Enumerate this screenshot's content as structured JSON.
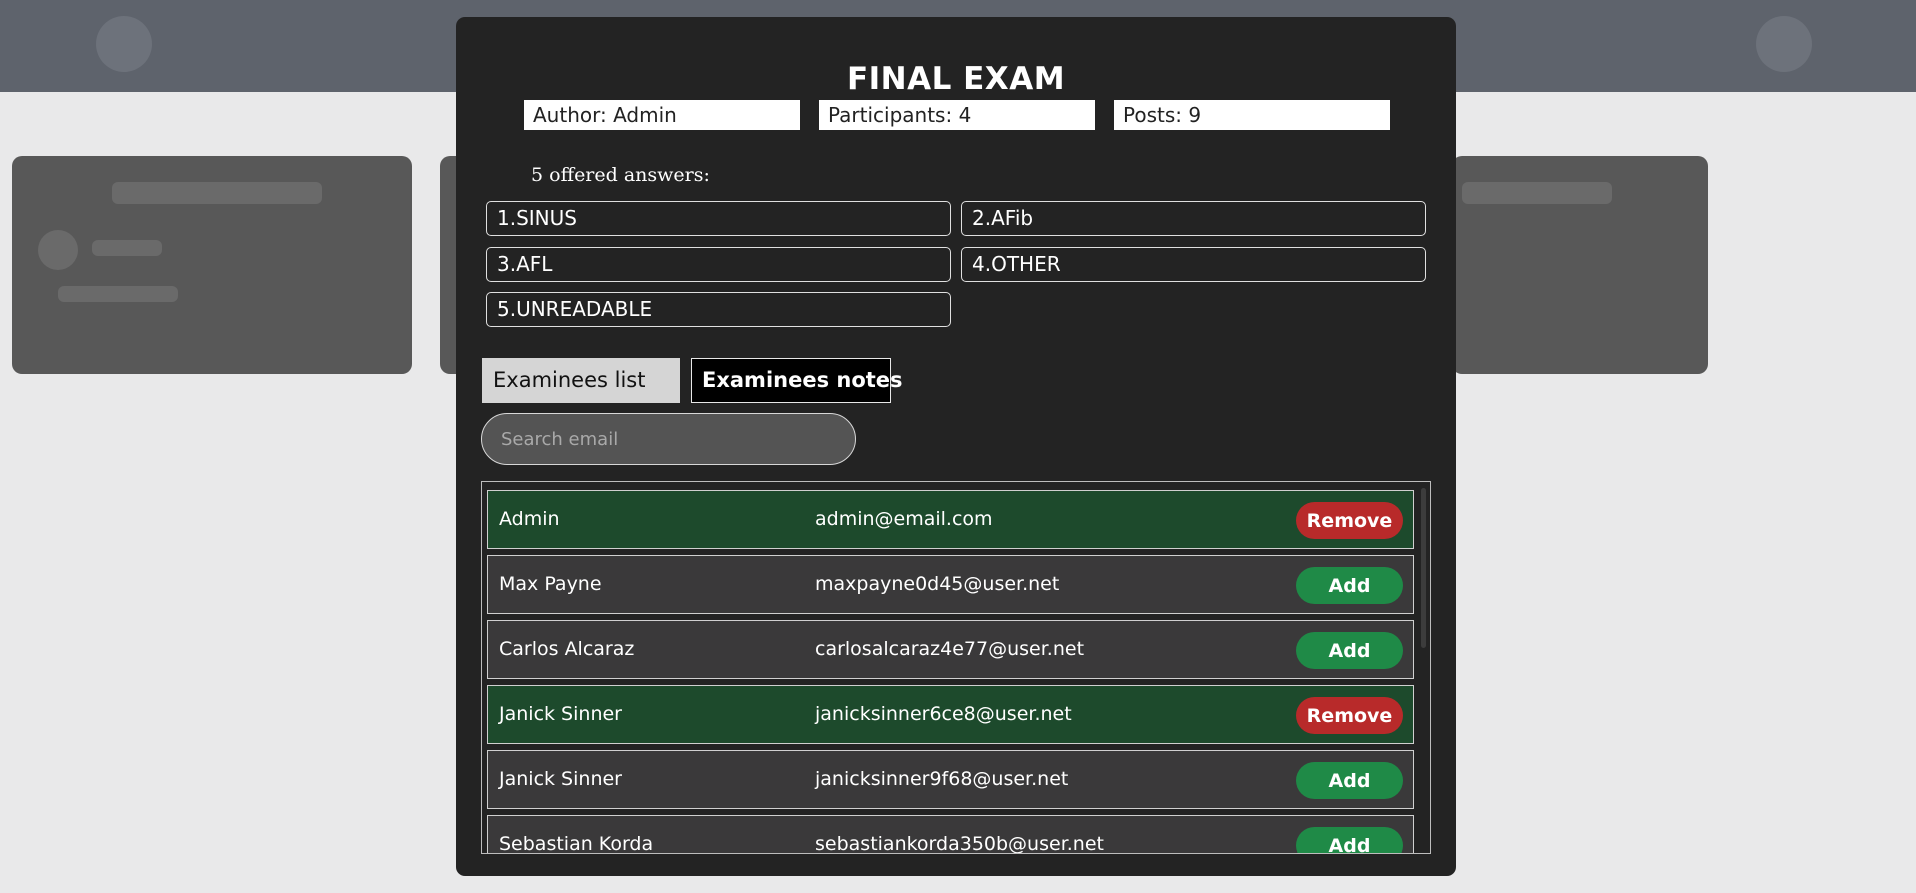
{
  "modal": {
    "title": "FINAL EXAM",
    "stats": {
      "author": "Author: Admin",
      "participants": "Participants: 4",
      "posts": "Posts: 9"
    },
    "answers_label": "5 offered answers:",
    "answers": [
      "1.SINUS",
      "2.AFib",
      "3.AFL",
      "4.OTHER",
      "5.UNREADABLE"
    ],
    "tabs": {
      "list": "Examinees list",
      "notes": "Examinees notes"
    },
    "search": {
      "placeholder": "Search email",
      "value": ""
    },
    "examinees": [
      {
        "name": "Admin",
        "email": "admin@email.com",
        "action": "Remove",
        "member": true
      },
      {
        "name": "Max Payne",
        "email": "maxpayne0d45@user.net",
        "action": "Add",
        "member": false
      },
      {
        "name": "Carlos Alcaraz",
        "email": "carlosalcaraz4e77@user.net",
        "action": "Add",
        "member": false
      },
      {
        "name": "Janick Sinner",
        "email": "janicksinner6ce8@user.net",
        "action": "Remove",
        "member": true
      },
      {
        "name": "Janick Sinner",
        "email": "janicksinner9f68@user.net",
        "action": "Add",
        "member": false
      },
      {
        "name": "Sebastian Korda",
        "email": "sebastiankorda350b@user.net",
        "action": "Add",
        "member": false
      }
    ]
  },
  "colors": {
    "modal_bg": "#232323",
    "member_row": "#1d4a2c",
    "nonmember_row": "#3a393a",
    "remove_button": "#b82a2a",
    "add_button": "#1f8a47"
  }
}
